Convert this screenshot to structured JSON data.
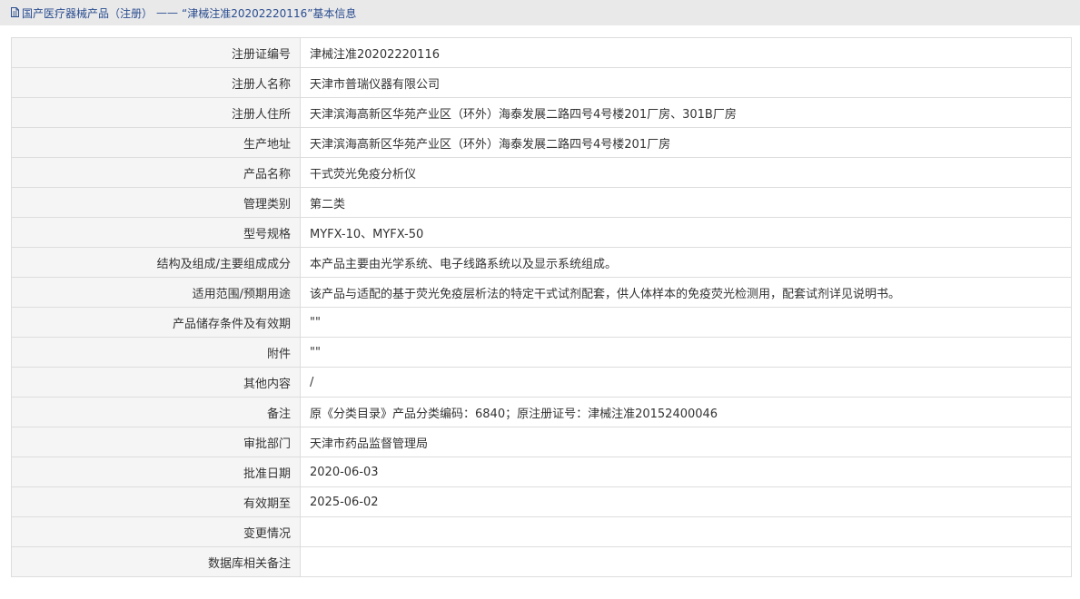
{
  "breadcrumb": {
    "category": "国产医疗器械产品（注册）",
    "separator": "——",
    "current": "“津械注准20202220116”基本信息"
  },
  "icons": {
    "breadcrumb_icon": "document-icon"
  },
  "colors": {
    "breadcrumb_text": "#2a4d8f",
    "topbar_bg": "#e9e9ea",
    "label_bg": "#f5f5f5",
    "border": "#dddddd"
  },
  "rows": [
    {
      "label": "注册证编号",
      "value": "津械注准20202220116"
    },
    {
      "label": "注册人名称",
      "value": "天津市普瑞仪器有限公司"
    },
    {
      "label": "注册人住所",
      "value": "天津滨海高新区华苑产业区（环外）海泰发展二路四号4号楼201厂房、301B厂房"
    },
    {
      "label": "生产地址",
      "value": "天津滨海高新区华苑产业区（环外）海泰发展二路四号4号楼201厂房"
    },
    {
      "label": "产品名称",
      "value": "干式荧光免疫分析仪"
    },
    {
      "label": "管理类别",
      "value": "第二类"
    },
    {
      "label": "型号规格",
      "value": "MYFX-10、MYFX-50"
    },
    {
      "label": "结构及组成/主要组成成分",
      "value": "本产品主要由光学系统、电子线路系统以及显示系统组成。"
    },
    {
      "label": "适用范围/预期用途",
      "value": "该产品与适配的基于荧光免疫层析法的特定干式试剂配套，供人体样本的免疫荧光检测用，配套试剂详见说明书。"
    },
    {
      "label": "产品储存条件及有效期",
      "value": "\"\""
    },
    {
      "label": "附件",
      "value": "\"\""
    },
    {
      "label": "其他内容",
      "value": "/"
    },
    {
      "label": "备注",
      "value": "原《分类目录》产品分类编码：6840；原注册证号：津械注准20152400046"
    },
    {
      "label": "审批部门",
      "value": "天津市药品监督管理局"
    },
    {
      "label": "批准日期",
      "value": "2020-06-03"
    },
    {
      "label": "有效期至",
      "value": "2025-06-02"
    },
    {
      "label": "变更情况",
      "value": ""
    },
    {
      "label": "数据库相关备注",
      "value": ""
    }
  ]
}
